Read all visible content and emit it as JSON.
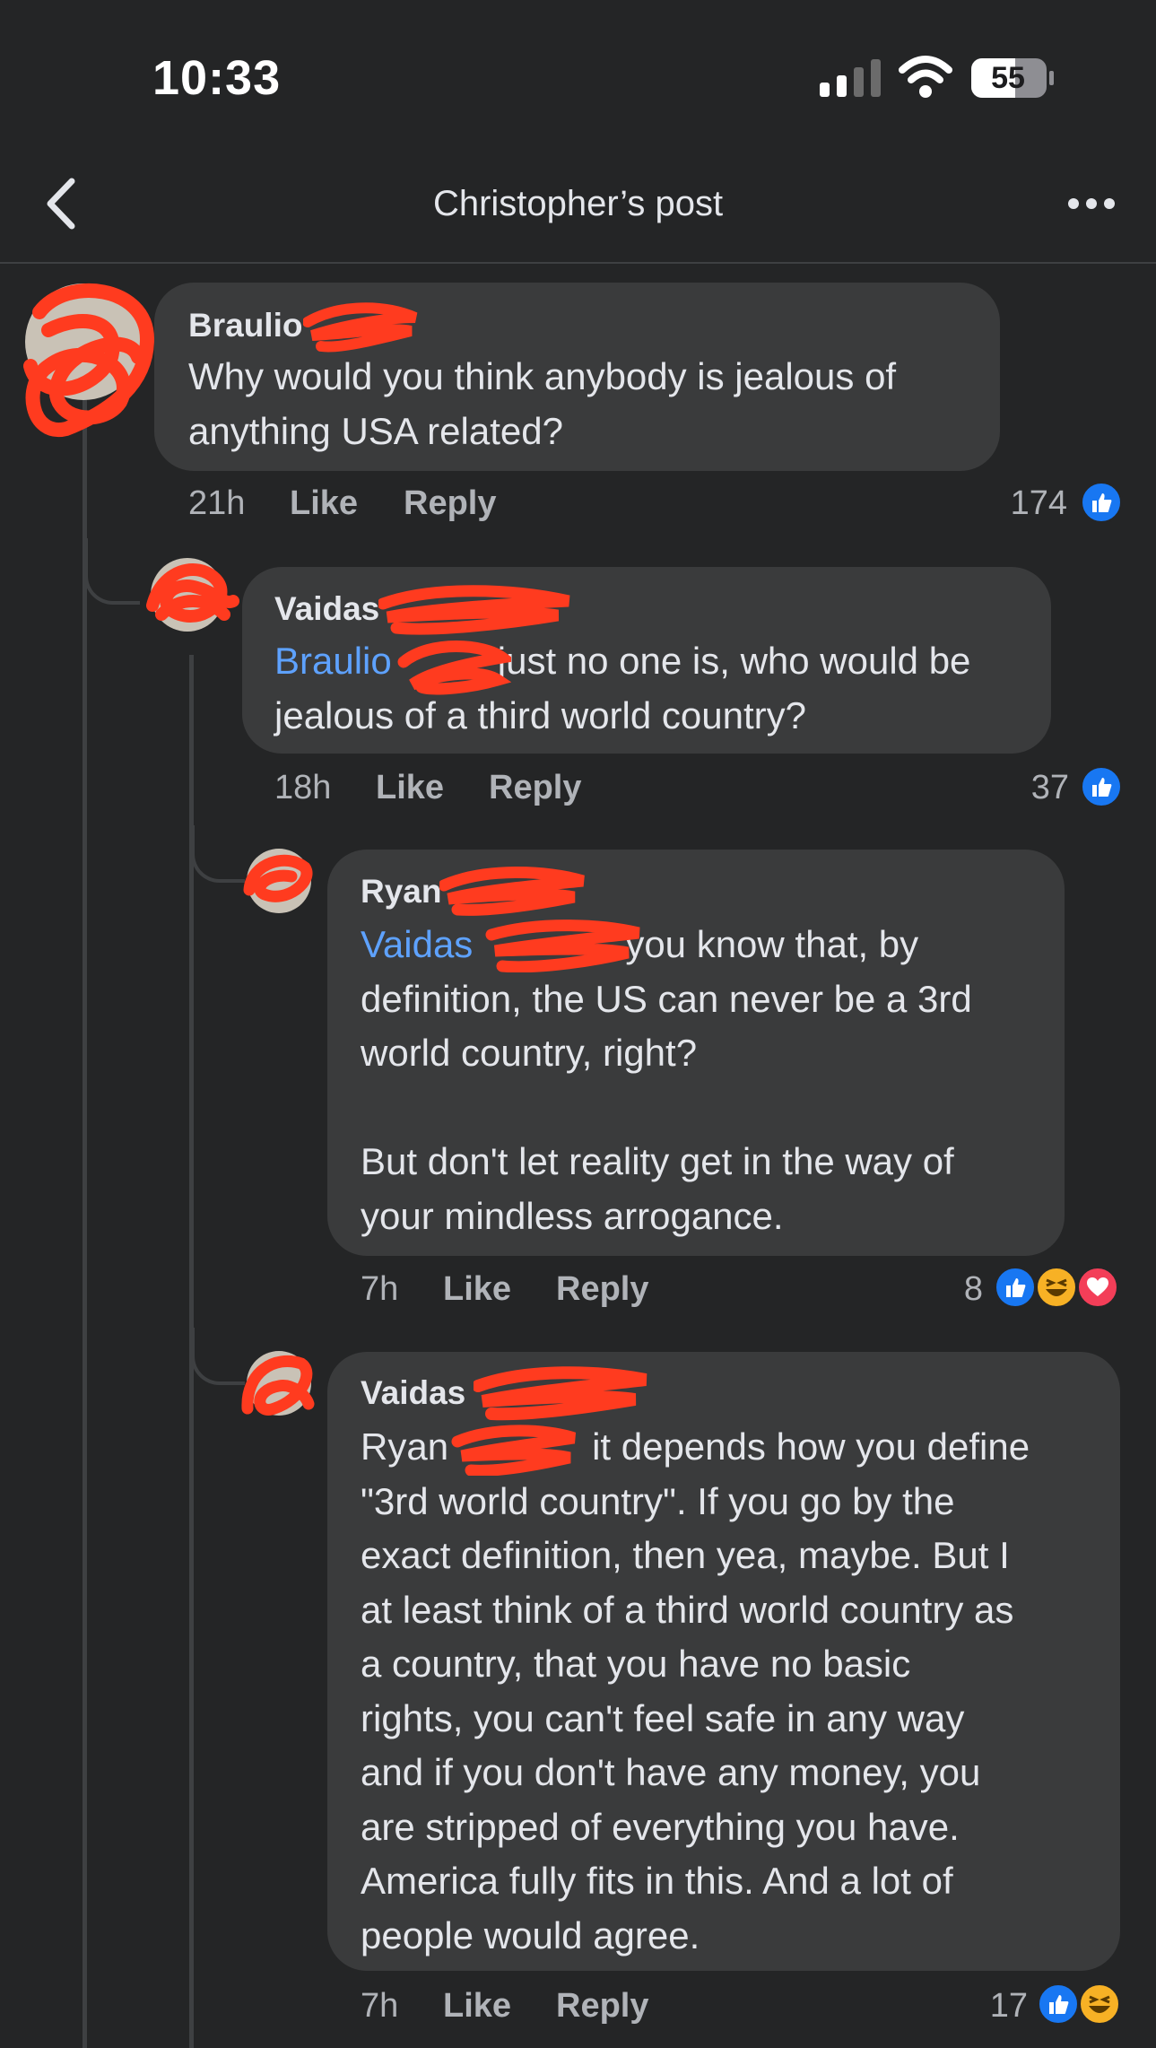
{
  "status_bar": {
    "time": "10:33",
    "battery": "55"
  },
  "header": {
    "title": "Christopher’s post"
  },
  "comments": [
    {
      "author": "Braulio",
      "mention": "",
      "text": "Why would you think anybody is jealous of\nanything USA related?",
      "time": "21h",
      "like_label": "Like",
      "reply_label": "Reply",
      "reaction_count": "174",
      "reactions": [
        "like-icon"
      ]
    },
    {
      "author": "Vaidas",
      "mention": "Braulio",
      "text": "just no one is, who would be\njealous of a third world country?",
      "time": "18h",
      "like_label": "Like",
      "reply_label": "Reply",
      "reaction_count": "37",
      "reactions": [
        "like-icon"
      ]
    },
    {
      "author": "Ryan",
      "mention": "Vaidas",
      "text": "you know that, by\ndefinition, the US can never be a 3rd\nworld country, right?\n\nBut don't let reality get in the way of\nyour mindless arrogance.",
      "time": "7h",
      "like_label": "Like",
      "reply_label": "Reply",
      "reaction_count": "8",
      "reactions": [
        "like-icon",
        "haha-icon",
        "love-icon"
      ]
    },
    {
      "author": "Vaidas",
      "mention": "Ryan",
      "text": "it depends how you define\n\"3rd world country\". If you go by the\nexact definition, then yea, maybe. But I\nat least think of a third world country as\na country, that you have no basic\nrights, you can't feel safe in any way\nand if you don't have any money, you\nare stripped of everything you have.\nAmerica fully fits in this. And a lot of\npeople would agree.",
      "time": "7h",
      "like_label": "Like",
      "reply_label": "Reply",
      "reaction_count": "17",
      "reactions": [
        "like-icon",
        "haha-icon"
      ]
    }
  ],
  "colors": {
    "background": "#242526",
    "bubble": "#3a3b3c",
    "mention": "#5ea2ff",
    "redaction": "#ff3b1f",
    "like": "#1877f2"
  }
}
